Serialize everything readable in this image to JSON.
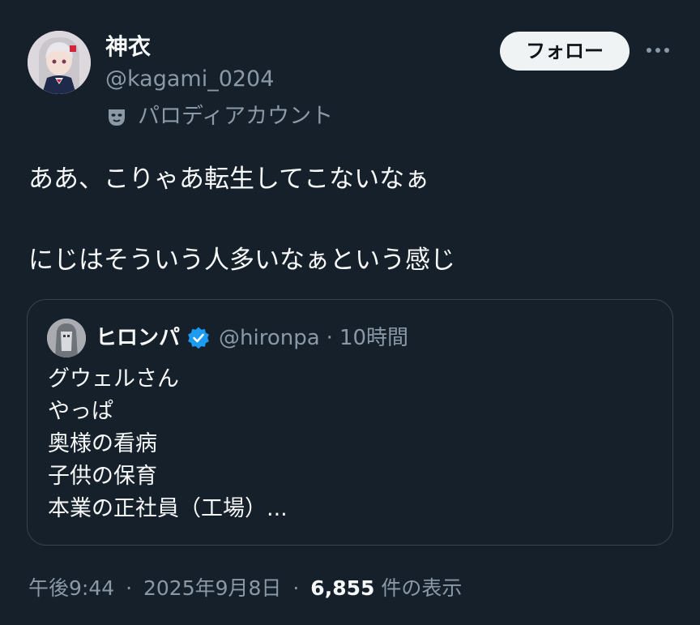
{
  "author": {
    "display_name": "神衣",
    "handle": "@kagami_0204",
    "parody_label": "パロディアカウント",
    "follow_label": "フォロー"
  },
  "body": {
    "line1": "ああ、こりゃあ転生してこないなぁ",
    "line2": "にじはそういう人多いなぁという感じ"
  },
  "quote": {
    "name": "ヒロンパ",
    "handle": "@hironpa",
    "separator": "·",
    "time": "10時間",
    "lines": [
      "グウェルさん",
      "やっぱ",
      "奥様の看病",
      "子供の保育",
      "本業の正社員（工場）..."
    ]
  },
  "footer": {
    "time": "午後9:44",
    "separator1": "·",
    "date": "2025年9月8日",
    "separator2": "·",
    "views_count": "6,855",
    "views_label": "件の表示"
  },
  "colors": {
    "background": "#15202b",
    "text_primary": "#f7f9f9",
    "text_secondary": "#8b98a5",
    "border": "#38444d",
    "follow_bg": "#eff3f4",
    "verified": "#1d9bf0"
  },
  "icons": {
    "more": "more-horizontal-icon",
    "parody": "mask-icon",
    "verified": "verified-badge-icon"
  }
}
